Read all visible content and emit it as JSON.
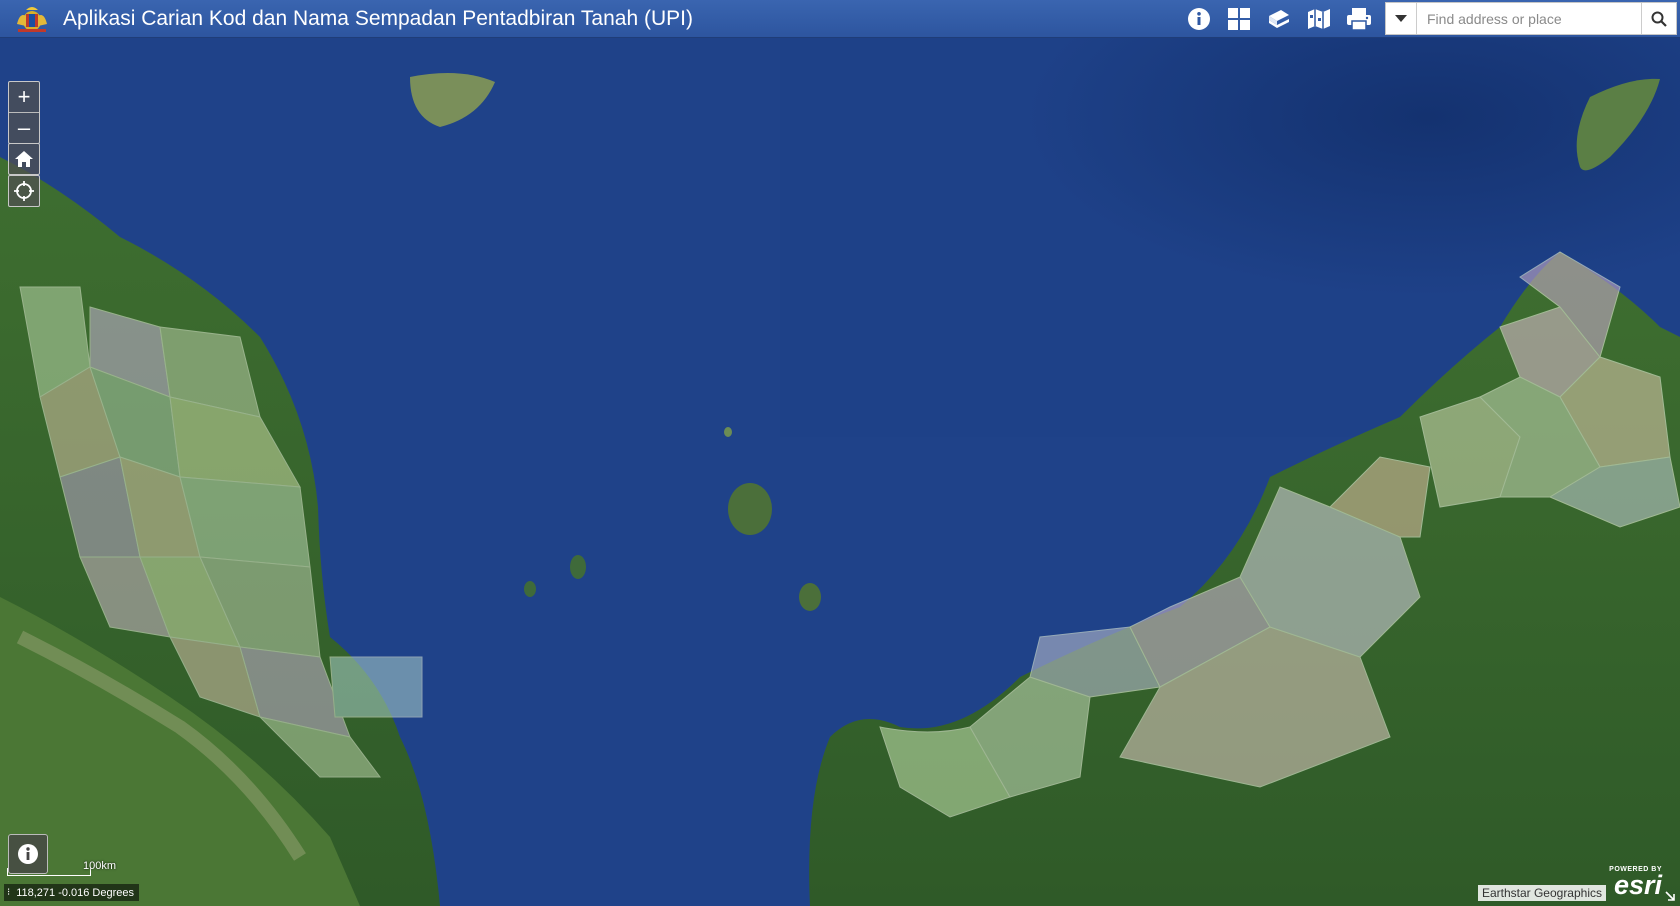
{
  "header": {
    "title": "Aplikasi Carian Kod dan Nama Sempadan Pentadbiran Tanah (UPI)",
    "logo": "malaysia-coat-of-arms",
    "background": "#2f58a3"
  },
  "toolbar": {
    "tools": [
      {
        "name": "about-tool",
        "icon": "info-icon"
      },
      {
        "name": "basemap-gallery-tool",
        "icon": "grid-icon"
      },
      {
        "name": "layer-list-tool",
        "icon": "layers-icon"
      },
      {
        "name": "legend-tool",
        "icon": "map-icon"
      },
      {
        "name": "print-tool",
        "icon": "print-icon"
      }
    ]
  },
  "search": {
    "placeholder": "Find address or place",
    "value": ""
  },
  "map_controls": {
    "zoom_in": "+",
    "zoom_out": "–"
  },
  "scalebar": {
    "label": "100km"
  },
  "coordinates": {
    "text": "118,271 -0.016 Degrees"
  },
  "attribution": {
    "text": "Earthstar Geographics"
  },
  "esri_logo": {
    "powered": "POWERED BY",
    "brand": "esri"
  },
  "colors": {
    "sea": "#1d3f86",
    "land": "#3f6f2e",
    "boundary": "#cde0c0"
  }
}
